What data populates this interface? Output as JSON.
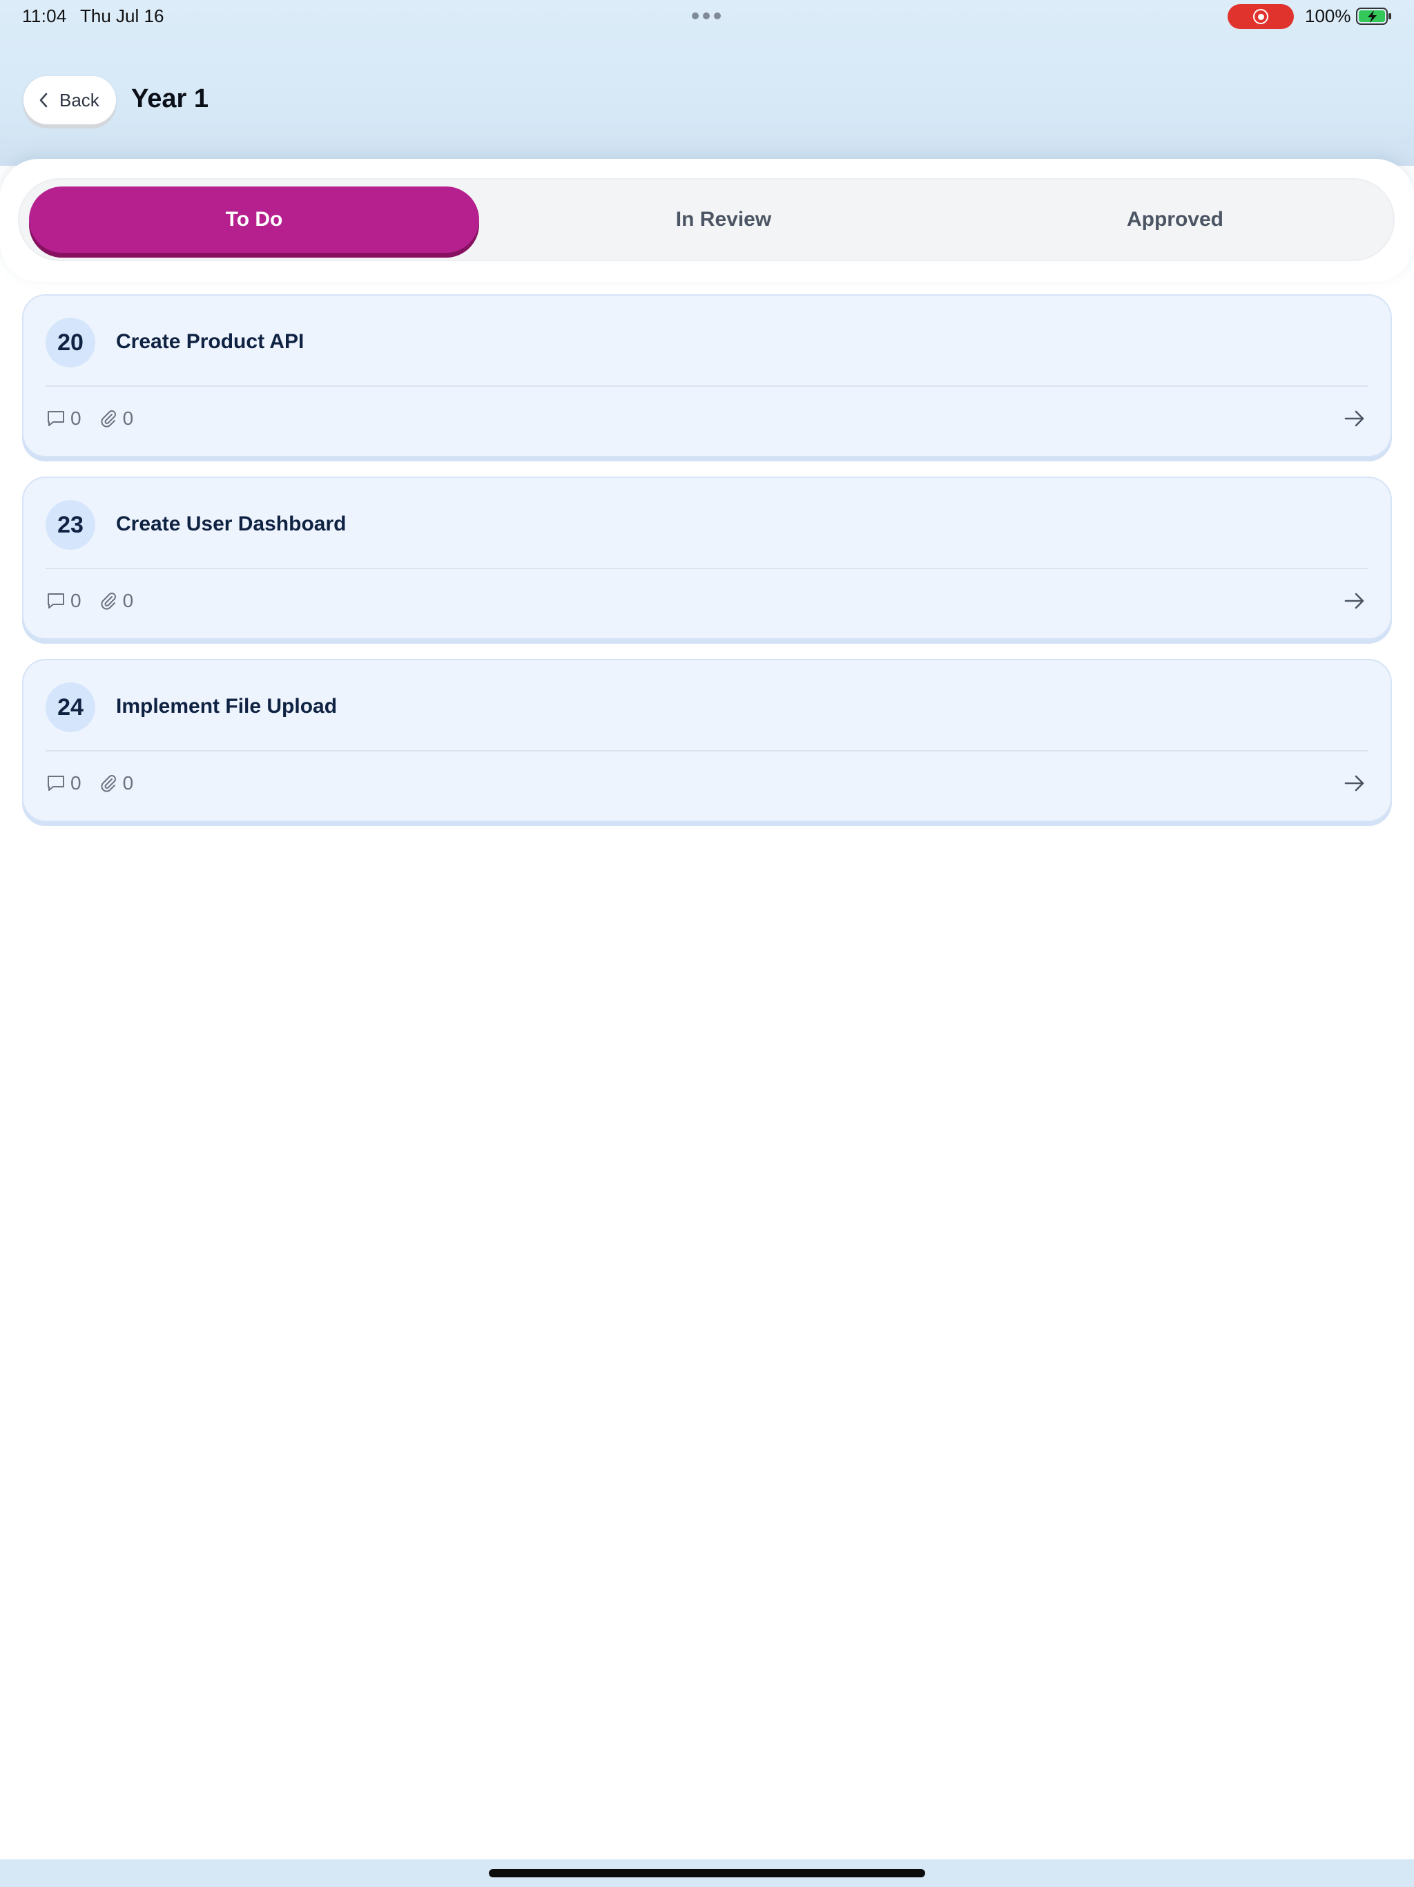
{
  "status_bar": {
    "time": "11:04",
    "date": "Thu Jul 16",
    "battery": "100%"
  },
  "header": {
    "back_label": "Back",
    "title": "Year 1"
  },
  "tabs": [
    {
      "label": "To Do",
      "active": true
    },
    {
      "label": "In Review",
      "active": false
    },
    {
      "label": "Approved",
      "active": false
    }
  ],
  "tasks": [
    {
      "number": "20",
      "title": "Create Product API",
      "comments": "0",
      "attachments": "0"
    },
    {
      "number": "23",
      "title": "Create User Dashboard",
      "comments": "0",
      "attachments": "0"
    },
    {
      "number": "24",
      "title": "Implement File Upload",
      "comments": "0",
      "attachments": "0"
    }
  ],
  "colors": {
    "accent": "#b5208e",
    "header_bg": "#dcecf9",
    "card_bg": "#edf4fe",
    "recording": "#e0332e"
  },
  "icons": {
    "back": "chevron-left-icon",
    "comment": "comment-icon",
    "attachment": "paperclip-icon",
    "open": "arrow-right-icon",
    "recording": "record-icon",
    "battery": "battery-charging-icon",
    "multitask": "more-dots-icon"
  }
}
